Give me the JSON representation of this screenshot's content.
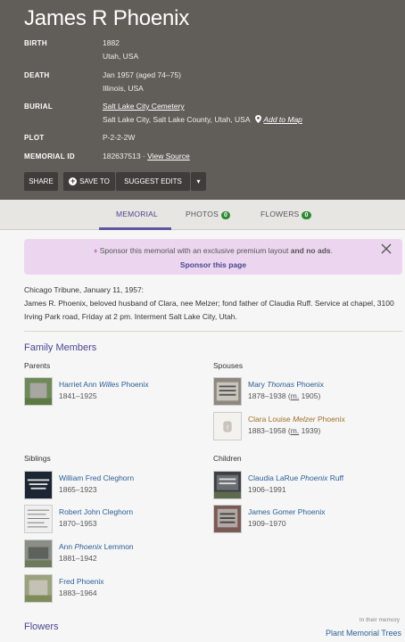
{
  "memorial": {
    "name": "James R Phoenix",
    "birth_label": "BIRTH",
    "birth_date": "1882",
    "birth_place": "Utah, USA",
    "death_label": "DEATH",
    "death_date": "Jan 1957 (aged 74–75)",
    "death_place": "Illinois, USA",
    "burial_label": "BURIAL",
    "burial_cemetery": "Salt Lake City Cemetery",
    "burial_place": "Salt Lake City, Salt Lake County, Utah, USA",
    "add_to_map": "Add to Map",
    "plot_label": "PLOT",
    "plot_value": "P-2-2-2W",
    "id_label": "MEMORIAL ID",
    "id_value": "182637513 ·",
    "view_source": "View Source"
  },
  "actions": {
    "share": "SHARE",
    "save": "SAVE TO",
    "suggest": "SUGGEST EDITS",
    "more": "▾"
  },
  "tabs": {
    "memorial": "MEMORIAL",
    "photos": "PHOTOS",
    "photos_count": "0",
    "flowers": "FLOWERS",
    "flowers_count": "0"
  },
  "sponsor": {
    "text_pre": "Sponsor this memorial with an exclusive premium layout",
    "text_bold": "and no ads",
    "text_post": ".",
    "link": "Sponsor this page"
  },
  "bio": {
    "line1": "Chicago Tribune, January 11, 1957:",
    "line2": "James R. Phoenix, beloved husband of Clara, nee Melzer; fond father of Claudia Ruff. Service at chapel, 3100 Irving Park road, Friday at 2 pm. Interment Salt Lake City, Utah."
  },
  "family": {
    "title": "Family Members",
    "parents_label": "Parents",
    "spouses_label": "Spouses",
    "siblings_label": "Siblings",
    "children_label": "Children",
    "parents": [
      {
        "pre": "Harriet Ann ",
        "mid": "Willes",
        "post": " Phoenix",
        "dates": "1841–1925"
      }
    ],
    "spouses": [
      {
        "pre": "Mary ",
        "mid": "Thomas",
        "post": " Phoenix",
        "dates": "1878–1938 (",
        "m": "m.",
        "mdate": " 1905)"
      },
      {
        "pre": "Clara Louise ",
        "mid": "Melzer",
        "post": " Phoenix",
        "dates": "1883–1958 (",
        "m": "m.",
        "mdate": " 1939)"
      }
    ],
    "siblings": [
      {
        "pre": "William Fred Cleghorn",
        "mid": "",
        "post": "",
        "dates": "1865–1923"
      },
      {
        "pre": "Robert John Cleghorn",
        "mid": "",
        "post": "",
        "dates": "1870–1953"
      },
      {
        "pre": "Ann ",
        "mid": "Phoenix",
        "post": " Lemmon",
        "dates": "1881–1942"
      },
      {
        "pre": "Fred Phoenix",
        "mid": "",
        "post": "",
        "dates": "1883–1964"
      }
    ],
    "children": [
      {
        "pre": "Claudia LaRue ",
        "mid": "Phoenix",
        "post": " Ruff",
        "dates": "1906–1991"
      },
      {
        "pre": "James Gomer Phoenix",
        "mid": "",
        "post": "",
        "dates": "1909–1970"
      }
    ]
  },
  "flowers": {
    "title": "Flowers",
    "in_memory": "In their memory",
    "plant": "Plant Memorial Trees"
  }
}
